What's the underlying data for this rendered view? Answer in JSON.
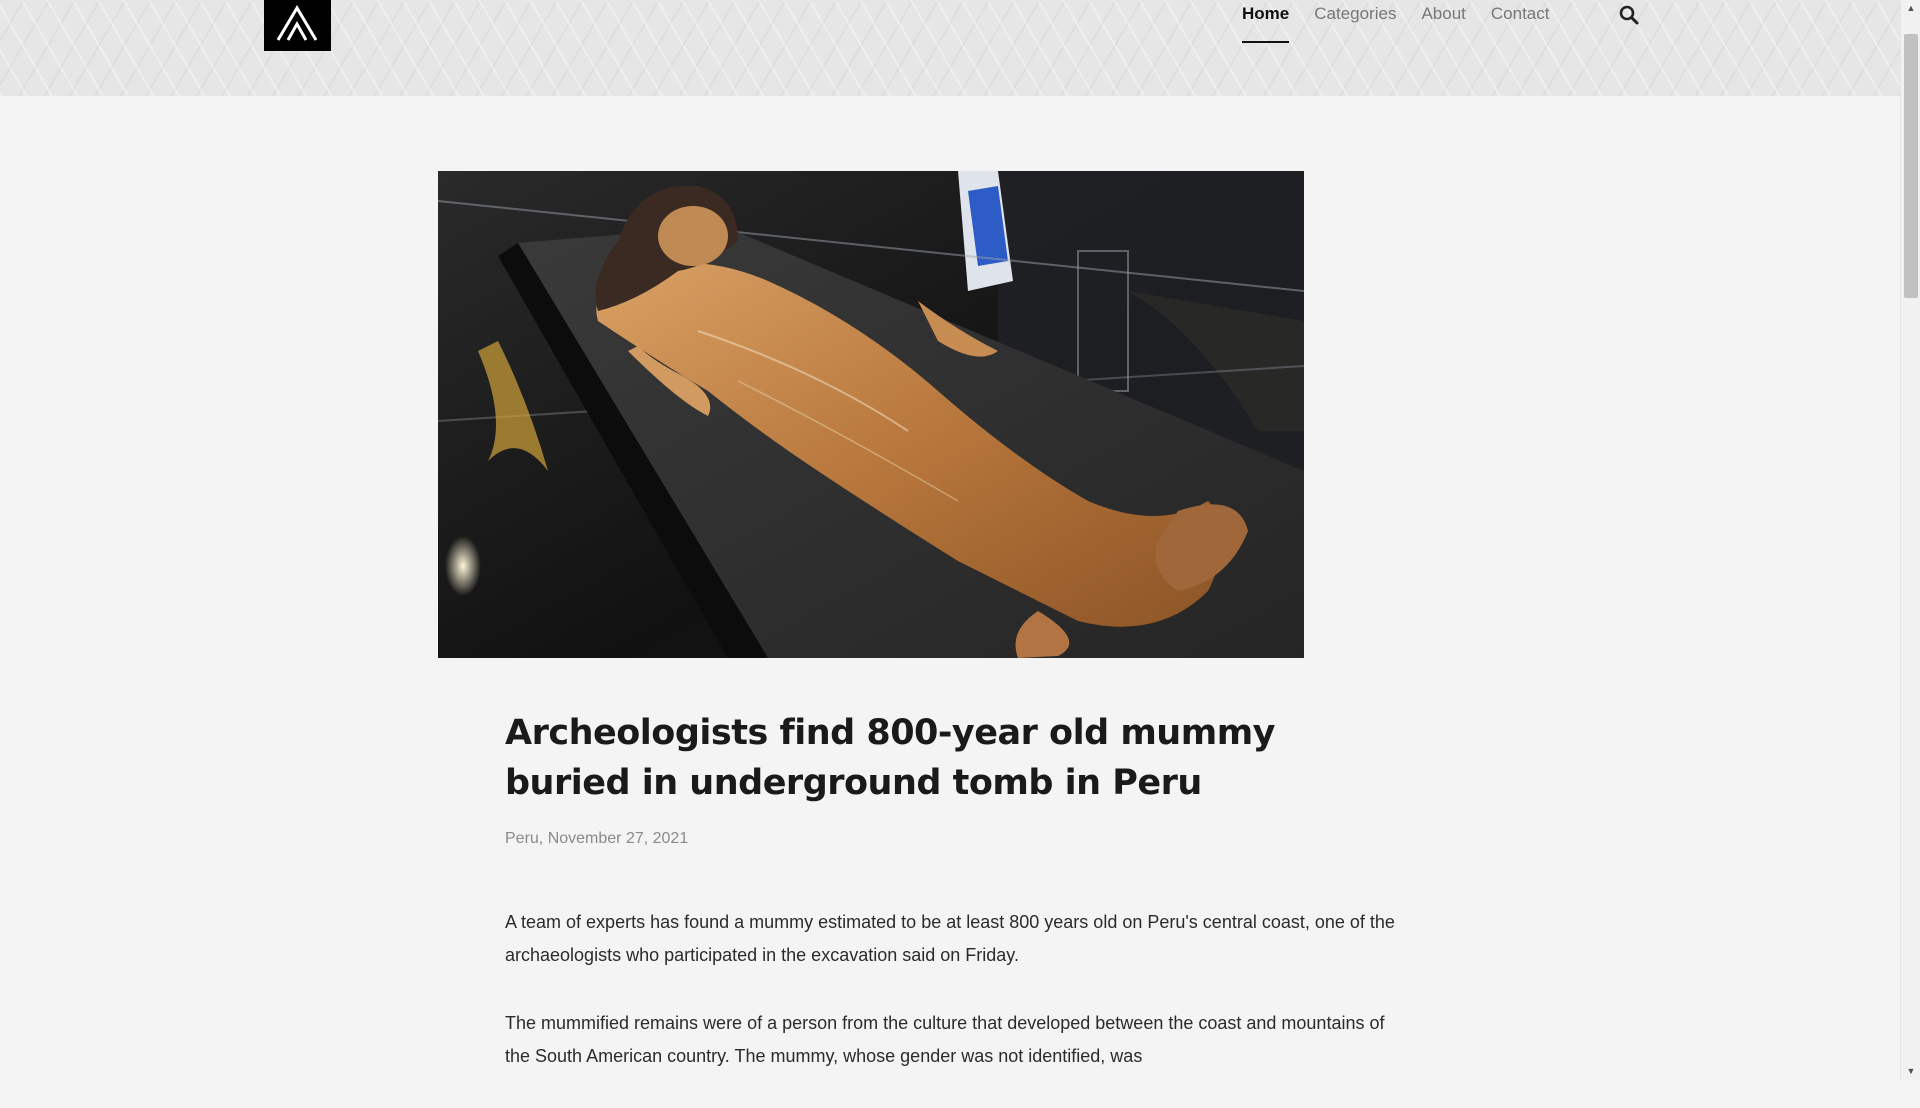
{
  "nav": {
    "items": [
      {
        "label": "Home",
        "active": true
      },
      {
        "label": "Categories",
        "active": false
      },
      {
        "label": "About",
        "active": false
      },
      {
        "label": "Contact",
        "active": false
      }
    ],
    "search_icon": "search-icon"
  },
  "logo": {
    "icon": "peaks-logo-icon"
  },
  "hero": {
    "icon": "mummy-photo"
  },
  "article": {
    "title": "Archeologists find 800-year old mummy buried in underground tomb in Peru",
    "meta": "Peru, November 27, 2021",
    "paragraphs": [
      "A team of experts has found a mummy estimated to be at least 800 years old on Peru's central coast, one of the archaeologists who participated in the excavation said on Friday.",
      "The mummified remains were of a person from the culture that developed between the coast and mountains of the South American country. The mummy, whose gender was not identified, was"
    ]
  },
  "colors": {
    "header_bg": "#e6e6e6",
    "page_bg": "#f4f4f4",
    "text": "#1a1a1a",
    "meta": "#8a8a8a"
  }
}
